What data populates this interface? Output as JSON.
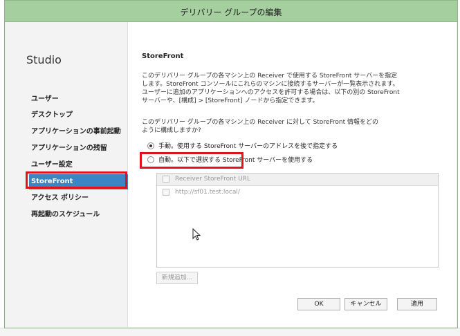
{
  "window": {
    "title": "デリバリー グループの編集"
  },
  "sidebar": {
    "heading": "Studio",
    "items": [
      {
        "label": "ユーザー"
      },
      {
        "label": "デスクトップ"
      },
      {
        "label": "アプリケーションの事前起動"
      },
      {
        "label": "アプリケーションの残留"
      },
      {
        "label": "ユーザー設定"
      },
      {
        "label": "StoreFront",
        "selected": true
      },
      {
        "label": "アクセス ポリシー"
      },
      {
        "label": "再起動のスケジュール"
      }
    ]
  },
  "main": {
    "title": "StoreFront",
    "description": [
      "このデリバリー グループの各マシン上の Receiver で使用する StoreFront サーバーを指定",
      "します。StoreFront コンソールにこれらのマシンに接続するサーバーが一覧表示されます。",
      "ユーザーに追加のアプリケーションへのアクセスを許可する場合は、以下の別の StoreFront",
      "サーバーや、[構成] > [StoreFront] ノードから指定できます。"
    ],
    "question": [
      "このデリバリー グループの各マシン上の Receiver に対して StoreFront 情報をどの",
      "ように構成しますか?"
    ],
    "options": [
      {
        "label": "手動。使用する StoreFront サーバーのアドレスを後で指定する",
        "checked": true
      },
      {
        "label": "自動。以下で選択する StoreFront サーバーを使用する",
        "checked": false
      }
    ],
    "url_list": {
      "header": "Receiver StoreFront URL",
      "rows": [
        "http://sf01.test.local/"
      ]
    },
    "add_button": "新規追加...",
    "ok_button": "OK",
    "cancel_button": "キャンセル",
    "apply_button": "適用"
  },
  "background": {
    "fragments": [
      "I ...",
      "...",
      "..."
    ]
  },
  "colors": {
    "titlebar": "#a6cfa0",
    "selected_item": "#3b85c4",
    "annotation": "#e0121b"
  }
}
